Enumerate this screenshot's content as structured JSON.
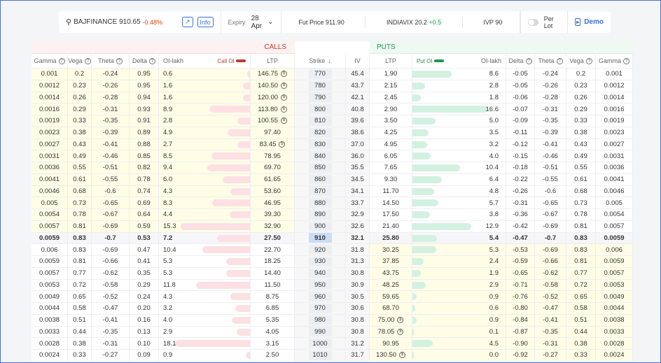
{
  "topbar": {
    "symbol": "BAJFINANCE",
    "price": "910.65",
    "change": "-0.48%",
    "info": "Info",
    "expiry_label": "Expiry",
    "expiry": "28 Apr",
    "fut_price": "Fut Price 911.90",
    "vix_label": "INDIAVIX 20.2",
    "vix_change": "+0.5",
    "ivp": "IVP 90",
    "per_lot": "Per Lot",
    "demo": "Demo"
  },
  "colors": {
    "accent": "#3d6fd8",
    "call_oi": "#c0392b",
    "put_oi": "#1a9a55",
    "itm": "#fffde6"
  },
  "groups": {
    "calls": "CALLS",
    "puts": "PUTS"
  },
  "headers": {
    "gamma": "Gamma",
    "vega": "Vega",
    "theta": "Theta",
    "delta": "Delta",
    "oi": "OI-lakh",
    "call_oi": "Call OI",
    "ltp": "LTP",
    "strike": "Strike",
    "iv": "IV",
    "put_oi": "Put OI"
  },
  "atm_strike": 910,
  "rows": [
    {
      "strike": "770",
      "iv": "45.4",
      "c": [
        "0.001",
        "0.2",
        "-0.24",
        "0.95",
        "0.6",
        "146.75"
      ],
      "cc": true,
      "p": [
        "1.90",
        "8.6",
        "-0.05",
        "-0.24",
        "0.2",
        "0.001"
      ],
      "pc": false
    },
    {
      "strike": "780",
      "iv": "43.7",
      "c": [
        "0.0012",
        "0.23",
        "-0.26",
        "0.95",
        "1.6",
        "140.50"
      ],
      "cc": true,
      "p": [
        "2.15",
        "2.8",
        "-0.05",
        "-0.26",
        "0.23",
        "0.0012"
      ],
      "pc": false
    },
    {
      "strike": "790",
      "iv": "42.1",
      "c": [
        "0.0014",
        "0.26",
        "-0.28",
        "0.94",
        "1.6",
        "120.00"
      ],
      "cc": true,
      "p": [
        "2.45",
        "1.8",
        "-0.06",
        "-0.28",
        "0.26",
        "0.0014"
      ],
      "pc": false
    },
    {
      "strike": "800",
      "iv": "40.8",
      "c": [
        "0.0016",
        "0.29",
        "-0.31",
        "0.93",
        "8.9",
        "113.80"
      ],
      "cc": true,
      "p": [
        "2.90",
        "16.6",
        "-0.07",
        "-0.31",
        "0.29",
        "0.0016"
      ],
      "pc": false
    },
    {
      "strike": "810",
      "iv": "39.6",
      "c": [
        "0.0019",
        "0.33",
        "-0.35",
        "0.91",
        "2.8",
        "100.55"
      ],
      "cc": true,
      "p": [
        "3.50",
        "5.0",
        "-0.09",
        "-0.35",
        "0.33",
        "0.0019"
      ],
      "pc": false
    },
    {
      "strike": "820",
      "iv": "38.6",
      "c": [
        "0.0023",
        "0.38",
        "-0.39",
        "0.89",
        "4.9",
        "97.40"
      ],
      "cc": false,
      "p": [
        "4.25",
        "3.5",
        "-0.11",
        "-0.39",
        "0.38",
        "0.0023"
      ],
      "pc": false
    },
    {
      "strike": "830",
      "iv": "37.0",
      "c": [
        "0.0027",
        "0.43",
        "-0.41",
        "0.88",
        "2.7",
        "83.45"
      ],
      "cc": true,
      "p": [
        "4.95",
        "3.2",
        "-0.12",
        "-0.41",
        "0.43",
        "0.0027"
      ],
      "pc": false
    },
    {
      "strike": "840",
      "iv": "36.0",
      "c": [
        "0.0031",
        "0.49",
        "-0.46",
        "0.85",
        "8.5",
        "78.95"
      ],
      "cc": false,
      "p": [
        "6.05",
        "4.0",
        "-0.15",
        "-0.46",
        "0.49",
        "0.0031"
      ],
      "pc": false
    },
    {
      "strike": "850",
      "iv": "35.5",
      "c": [
        "0.0036",
        "0.55",
        "-0.51",
        "0.82",
        "9.4",
        "69.70"
      ],
      "cc": false,
      "p": [
        "7.65",
        "10.4",
        "-0.18",
        "-0.51",
        "0.55",
        "0.0036"
      ],
      "pc": false
    },
    {
      "strike": "860",
      "iv": "34.5",
      "c": [
        "0.0041",
        "0.61",
        "-0.55",
        "0.78",
        "6.0",
        "61.65"
      ],
      "cc": false,
      "p": [
        "9.30",
        "6.4",
        "-0.22",
        "-0.55",
        "0.61",
        "0.0041"
      ],
      "pc": false
    },
    {
      "strike": "870",
      "iv": "34.1",
      "c": [
        "0.0046",
        "0.68",
        "-0.6",
        "0.74",
        "4.3",
        "53.60"
      ],
      "cc": false,
      "p": [
        "11.70",
        "4.8",
        "-0.26",
        "-0.6",
        "0.68",
        "0.0046"
      ],
      "pc": false
    },
    {
      "strike": "880",
      "iv": "33.7",
      "c": [
        "0.005",
        "0.73",
        "-0.65",
        "0.69",
        "8.3",
        "46.95"
      ],
      "cc": false,
      "p": [
        "14.50",
        "5.7",
        "-0.31",
        "-0.65",
        "0.73",
        "0.005"
      ],
      "pc": false
    },
    {
      "strike": "890",
      "iv": "32.9",
      "c": [
        "0.0054",
        "0.78",
        "-0.67",
        "0.64",
        "4.4",
        "39.30"
      ],
      "cc": false,
      "p": [
        "17.50",
        "3.8",
        "-0.36",
        "-0.67",
        "0.78",
        "0.0054"
      ],
      "pc": false
    },
    {
      "strike": "900",
      "iv": "32.6",
      "c": [
        "0.0057",
        "0.81",
        "-0.69",
        "0.59",
        "15.3",
        "32.90"
      ],
      "cc": false,
      "p": [
        "21.40",
        "12.9",
        "-0.42",
        "-0.69",
        "0.81",
        "0.0057"
      ],
      "pc": false
    },
    {
      "strike": "910",
      "iv": "32.1",
      "c": [
        "0.0059",
        "0.83",
        "-0.7",
        "0.53",
        "7.2",
        "27.50"
      ],
      "cc": false,
      "p": [
        "25.80",
        "5.4",
        "-0.47",
        "-0.7",
        "0.83",
        "0.0059"
      ],
      "pc": false
    },
    {
      "strike": "920",
      "iv": "31.8",
      "c": [
        "0.006",
        "0.83",
        "-0.69",
        "0.47",
        "10.4",
        "22.70"
      ],
      "cc": false,
      "p": [
        "30.25",
        "5.3",
        "-0.53",
        "-0.69",
        "0.83",
        "0.006"
      ],
      "pc": false
    },
    {
      "strike": "930",
      "iv": "31.3",
      "c": [
        "0.0059",
        "0.81",
        "-0.66",
        "0.41",
        "5.3",
        "18.25"
      ],
      "cc": false,
      "p": [
        "37.85",
        "2.4",
        "-0.59",
        "-0.66",
        "0.81",
        "0.0059"
      ],
      "pc": false
    },
    {
      "strike": "940",
      "iv": "30.8",
      "c": [
        "0.0057",
        "0.77",
        "-0.62",
        "0.35",
        "5.3",
        "14.40"
      ],
      "cc": false,
      "p": [
        "43.75",
        "1.9",
        "-0.65",
        "-0.62",
        "0.77",
        "0.0057"
      ],
      "pc": false
    },
    {
      "strike": "950",
      "iv": "30.9",
      "c": [
        "0.0053",
        "0.72",
        "-0.58",
        "0.29",
        "11.8",
        "11.50"
      ],
      "cc": false,
      "p": [
        "48.25",
        "2.9",
        "-0.71",
        "-0.58",
        "0.72",
        "0.0053"
      ],
      "pc": false
    },
    {
      "strike": "960",
      "iv": "30.5",
      "c": [
        "0.0049",
        "0.65",
        "-0.52",
        "0.24",
        "4.3",
        "8.75"
      ],
      "cc": false,
      "p": [
        "59.65",
        "0.9",
        "-0.76",
        "-0.52",
        "0.65",
        "0.0049"
      ],
      "pc": false
    },
    {
      "strike": "970",
      "iv": "30.6",
      "c": [
        "0.0044",
        "0.58",
        "-0.47",
        "0.20",
        "3.2",
        "6.85"
      ],
      "cc": false,
      "p": [
        "68.70",
        "0.6",
        "-0.80",
        "-0.47",
        "0.58",
        "0.0044"
      ],
      "pc": false
    },
    {
      "strike": "980",
      "iv": "30.8",
      "c": [
        "0.0038",
        "0.51",
        "-0.41",
        "0.16",
        "4.0",
        "5.35"
      ],
      "cc": false,
      "p": [
        "75.00",
        "0.9",
        "-0.84",
        "-0.41",
        "0.51",
        "0.0038"
      ],
      "pc": true
    },
    {
      "strike": "990",
      "iv": "30.8",
      "c": [
        "0.0033",
        "0.44",
        "-0.35",
        "0.13",
        "2.9",
        "4.05"
      ],
      "cc": false,
      "p": [
        "78.05",
        "0.1",
        "-0.87",
        "-0.35",
        "0.44",
        "0.0033"
      ],
      "pc": true
    },
    {
      "strike": "1000",
      "iv": "31.2",
      "c": [
        "0.0028",
        "0.38",
        "-0.31",
        "0.10",
        "18.1",
        "3.15"
      ],
      "cc": false,
      "p": [
        "90.95",
        "4.5",
        "-0.90",
        "-0.31",
        "0.38",
        "0.0028"
      ],
      "pc": false
    },
    {
      "strike": "1010",
      "iv": "31.7",
      "c": [
        "0.0024",
        "0.33",
        "-0.27",
        "0.09",
        "0.9",
        "2.50"
      ],
      "cc": false,
      "p": [
        "130.50",
        "0.0",
        "-0.92",
        "-0.27",
        "0.33",
        "0.0024"
      ],
      "pc": true
    }
  ]
}
